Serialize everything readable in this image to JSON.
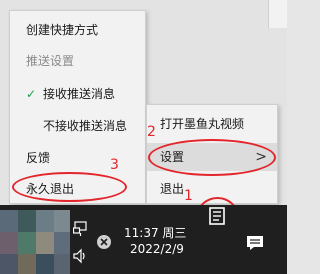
{
  "context_menu": {
    "items": [
      {
        "label": "创建快捷方式"
      },
      {
        "label": "推送设置"
      },
      {
        "label": "接收推送消息"
      },
      {
        "label": "不接收推送消息"
      },
      {
        "label": "反馈"
      },
      {
        "label": "永久退出"
      }
    ],
    "check_mark": "✓"
  },
  "submenu": {
    "items": [
      {
        "label": "打开墨鱼丸视频"
      },
      {
        "label": "设置"
      },
      {
        "label": "退出"
      }
    ],
    "arrow": ">"
  },
  "annotations": {
    "step1": "1",
    "step2": "2",
    "step3": "3",
    "color": "#e2262b"
  },
  "taskbar": {
    "time": "11:37 周三",
    "date": "2022/2/9"
  }
}
